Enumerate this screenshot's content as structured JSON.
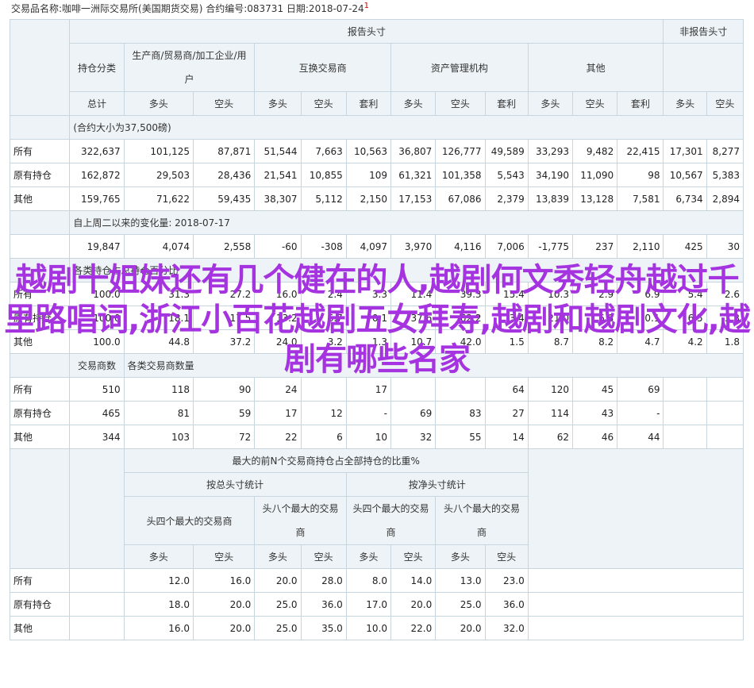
{
  "header": {
    "text": "交易品名称:咖啡一洲际交易所(美国期货交易)  合约编号:083731  日期:2018-07-24",
    "mark": "1"
  },
  "table1": {
    "top_report": "报告头寸",
    "top_nonreport": "非报告头寸",
    "holding_class": "持仓分类",
    "groups": [
      "生产商/贸易商/加工企业/用户",
      "互换交易商",
      "资产管理机构",
      "其他"
    ],
    "subheaders": [
      "总计",
      "多头",
      "空头",
      "多头",
      "空头",
      "套利",
      "多头",
      "空头",
      "套利",
      "多头",
      "空头",
      "套利",
      "多头",
      "空头"
    ],
    "section_oi": "(合约大小为37,500磅)",
    "oi_rows": [
      {
        "label": "所有",
        "cells": [
          "322,637",
          "101,125",
          "87,871",
          "51,544",
          "7,663",
          "10,563",
          "36,807",
          "126,777",
          "49,589",
          "33,293",
          "9,482",
          "22,415",
          "17,301",
          "8,277"
        ]
      },
      {
        "label": "原有持仓",
        "cells": [
          "162,872",
          "29,503",
          "28,436",
          "21,541",
          "10,855",
          "109",
          "61,321",
          "101,358",
          "5,543",
          "34,190",
          "11,090",
          "98",
          "10,567",
          "5,383"
        ]
      },
      {
        "label": "其他",
        "cells": [
          "159,765",
          "71,622",
          "59,435",
          "38,307",
          "5,112",
          "2,150",
          "17,153",
          "67,086",
          "2,379",
          "13,839",
          "13,128",
          "7,581",
          "6,734",
          "2,894"
        ]
      }
    ],
    "section_change": "自上周二以来的变化量:  2018-07-17",
    "change_row": {
      "label": "",
      "cells": [
        "19,847",
        "4,074",
        "2,558",
        "-60",
        "-308",
        "4,097",
        "3,970",
        "4,116",
        "7,006",
        "-1,775",
        "237",
        "2,110",
        "425",
        "30"
      ]
    },
    "section_pct": "各类持仓占总持仓百分比",
    "pct_rows": [
      {
        "label": "所有",
        "cells": [
          "100.0",
          "31.3",
          "27.2",
          "16.0",
          "2.4",
          "3.3",
          "11.4",
          "39.3",
          "15.4",
          "10.3",
          "2.9",
          "6.9",
          "5.4",
          "2.6"
        ]
      },
      {
        "label": "原有持仓",
        "cells": [
          "100.0",
          "18.1",
          "17.5",
          "13.2",
          "6.7",
          "0.1",
          "37.6",
          "62.2",
          "3.4",
          "21.0",
          "6.8",
          "0.1",
          "6.5",
          "3.3"
        ]
      },
      {
        "label": "其他",
        "cells": [
          "100.0",
          "44.8",
          "37.2",
          "24.0",
          "3.2",
          "1.3",
          "10.7",
          "42.0",
          "1.5",
          "8.7",
          "8.2",
          "4.7",
          "4.2",
          "1.8"
        ]
      }
    ],
    "trader_count_label": "交易商数",
    "section_count": "各类交易商数量",
    "count_rows": [
      {
        "label": "所有",
        "cells": [
          "510",
          "118",
          "90",
          "24",
          "",
          "17",
          "",
          "",
          "64",
          "120",
          "45",
          "69",
          "",
          ""
        ]
      },
      {
        "label": "原有持仓",
        "cells": [
          "465",
          "81",
          "59",
          "17",
          "12",
          "-",
          "69",
          "83",
          "27",
          "114",
          "43",
          "-",
          "",
          ""
        ]
      },
      {
        "label": "其他",
        "cells": [
          "344",
          "103",
          "72",
          "22",
          "6",
          "10",
          "32",
          "55",
          "14",
          "62",
          "46",
          "44",
          "",
          ""
        ]
      }
    ]
  },
  "table2": {
    "title": "最大的前N个交易商持仓占全部持仓的比重%",
    "gross": "按总头寸统计",
    "net": "按净头寸统计",
    "col_groups": [
      "头四个最大的交易商",
      "头八个最大的交易商",
      "头四个最大的交易商",
      "头八个最大的交易商"
    ],
    "subheaders": [
      "多头",
      "空头",
      "多头",
      "空头",
      "多头",
      "空头",
      "多头",
      "空头"
    ],
    "rows": [
      {
        "label": "所有",
        "cells": [
          "12.0",
          "16.0",
          "20.0",
          "28.0",
          "8.0",
          "14.0",
          "13.0",
          "23.0"
        ]
      },
      {
        "label": "原有持仓",
        "cells": [
          "18.0",
          "20.0",
          "25.0",
          "36.0",
          "17.0",
          "20.0",
          "25.0",
          "36.0"
        ]
      },
      {
        "label": "其他",
        "cells": [
          "16.0",
          "20.0",
          "25.0",
          "35.0",
          "10.0",
          "22.0",
          "20.0",
          "32.0"
        ]
      }
    ]
  },
  "overlay_text": "越剧十姐妹还有几个健在的人,越剧何文秀轻舟越过千里路唱词,浙江小百花越剧五女拜寿,越剧和越剧文化,越剧有哪些名家"
}
